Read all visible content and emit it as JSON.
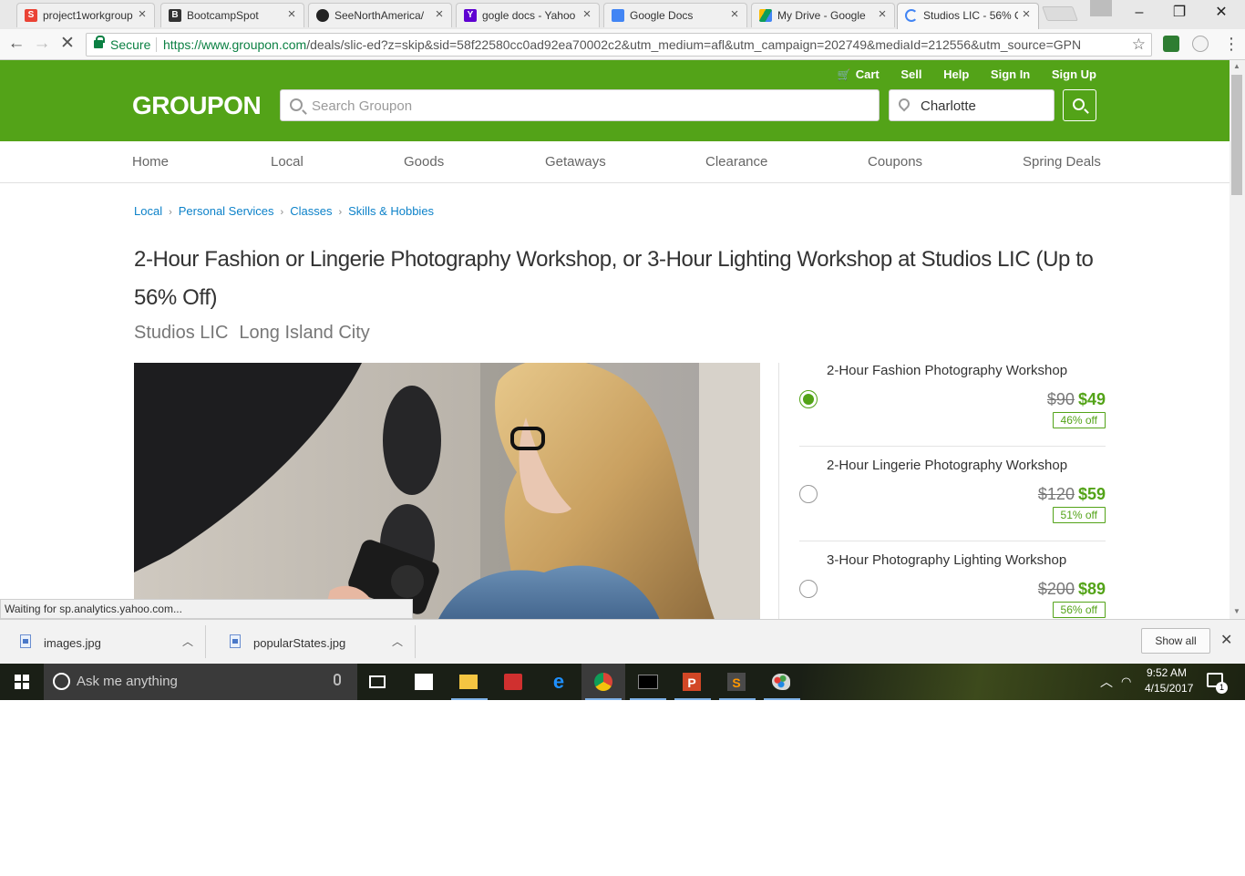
{
  "browser": {
    "tabs": [
      {
        "title": "project1workgroup",
        "favicon": "S",
        "favicon_color": "#ea4335"
      },
      {
        "title": "BootcampSpot",
        "favicon": "B",
        "favicon_color": "#333333"
      },
      {
        "title": "SeeNorthAmerica/",
        "favicon": "",
        "favicon_color": "#222222"
      },
      {
        "title": "gogle docs - Yahoo",
        "favicon": "Y",
        "favicon_color": "#5f01d1"
      },
      {
        "title": "Google Docs",
        "favicon": "",
        "favicon_color": "#4285f4"
      },
      {
        "title": "My Drive - Google",
        "favicon": "",
        "favicon_color": "#0f9d58"
      },
      {
        "title": "Studios LIC - 56% O",
        "favicon": "",
        "favicon_color": "#4285f4"
      }
    ],
    "secure_label": "Secure",
    "url_host": "https://www.groupon.com",
    "url_path": "/deals/slic-ed?z=skip&sid=58f22580cc0ad92ea70002c2&utm_medium=afl&utm_campaign=202749&mediaId=212556&utm_source=GPN",
    "status_text": "Waiting for sp.analytics.yahoo.com..."
  },
  "header": {
    "logo": "GROUPON",
    "utility_links": [
      "Cart",
      "Sell",
      "Help",
      "Sign In",
      "Sign Up"
    ],
    "search_placeholder": "Search Groupon",
    "location_value": "Charlotte",
    "brand_color": "#53a318"
  },
  "nav": [
    "Home",
    "Local",
    "Goods",
    "Getaways",
    "Clearance",
    "Coupons",
    "Spring Deals"
  ],
  "breadcrumb": [
    "Local",
    "Personal Services",
    "Classes",
    "Skills & Hobbies"
  ],
  "deal": {
    "title": "2-Hour Fashion or Lingerie Photography Workshop, or 3-Hour Lighting Workshop at Studios LIC (Up to 56% Off)",
    "merchant": "Studios LIC",
    "location": "Long Island City",
    "options": [
      {
        "title": "2-Hour Fashion Photography Workshop",
        "old_price": "$90",
        "new_price": "$49",
        "discount": "46% off",
        "selected": true
      },
      {
        "title": "2-Hour Lingerie Photography Workshop",
        "old_price": "$120",
        "new_price": "$59",
        "discount": "51% off",
        "selected": false
      },
      {
        "title": "3-Hour Photography Lighting Workshop",
        "old_price": "$200",
        "new_price": "$89",
        "discount": "56% off",
        "selected": false
      }
    ]
  },
  "downloads": {
    "items": [
      "images.jpg",
      "popularStates.jpg"
    ],
    "show_all": "Show all"
  },
  "taskbar": {
    "search_placeholder": "Ask me anything",
    "time": "9:52 AM",
    "date": "4/15/2017",
    "notification_count": "1"
  }
}
